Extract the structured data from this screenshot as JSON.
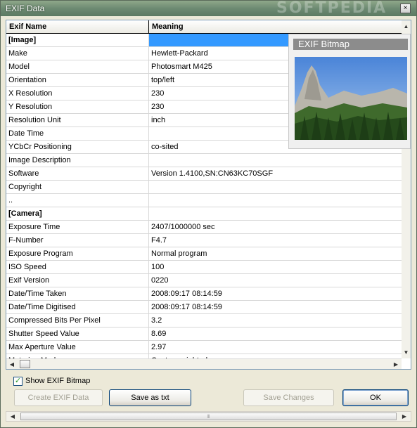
{
  "window": {
    "title": "EXIF Data",
    "watermark": "SOFTPEDIA",
    "close_label": "×"
  },
  "grid": {
    "headers": [
      "Exif Name",
      "Meaning"
    ],
    "rows": [
      {
        "name": "[Image]",
        "meaning": "",
        "section": true,
        "selected": true
      },
      {
        "name": "Make",
        "meaning": "Hewlett-Packard"
      },
      {
        "name": "Model",
        "meaning": "Photosmart M425"
      },
      {
        "name": "Orientation",
        "meaning": "top/left"
      },
      {
        "name": "X Resolution",
        "meaning": "230"
      },
      {
        "name": "Y Resolution",
        "meaning": "230"
      },
      {
        "name": "Resolution Unit",
        "meaning": "inch"
      },
      {
        "name": "Date Time",
        "meaning": ""
      },
      {
        "name": "YCbCr Positioning",
        "meaning": "co-sited"
      },
      {
        "name": "Image Description",
        "meaning": ""
      },
      {
        "name": "Software",
        "meaning": "Version 1.4100,SN:CN63KC70SGF"
      },
      {
        "name": "Copyright",
        "meaning": ""
      },
      {
        "name": "..",
        "meaning": ""
      },
      {
        "name": "[Camera]",
        "meaning": "",
        "section": true
      },
      {
        "name": "Exposure Time",
        "meaning": "2407/1000000 sec"
      },
      {
        "name": "F-Number",
        "meaning": "F4.7"
      },
      {
        "name": "Exposure Program",
        "meaning": "Normal program"
      },
      {
        "name": "ISO Speed",
        "meaning": "100"
      },
      {
        "name": "Exif Version",
        "meaning": "0220"
      },
      {
        "name": "Date/Time Taken",
        "meaning": "2008:09:17 08:14:59"
      },
      {
        "name": "Date/Time Digitised",
        "meaning": "2008:09:17 08:14:59"
      },
      {
        "name": "Compressed Bits Per Pixel",
        "meaning": "3.2"
      },
      {
        "name": "Shutter Speed Value",
        "meaning": "8.69"
      },
      {
        "name": "Max Aperture Value",
        "meaning": "2.97"
      },
      {
        "name": "Metering Mode",
        "meaning": "Center weighted average"
      }
    ]
  },
  "bitmap_panel": {
    "title": "EXIF Bitmap"
  },
  "options": {
    "show_bitmap_label": "Show EXIF Bitmap",
    "show_bitmap_checked": true
  },
  "buttons": {
    "create": "Create EXIF Data",
    "save_txt": "Save as txt",
    "save_changes": "Save Changes",
    "ok": "OK"
  },
  "colors": {
    "selection": "#3399ff",
    "window_bg": "#ece9d8",
    "title_bar": "#6d8a72"
  }
}
